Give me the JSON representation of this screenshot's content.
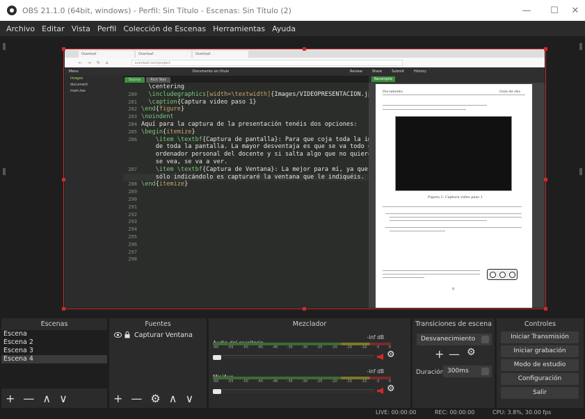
{
  "window": {
    "title": "OBS 21.1.0 (64bit, windows) - Perfil: Sin Título - Escenas: Sin Título (2)",
    "minimize": "—",
    "maximize": "☐",
    "close": "✕"
  },
  "menu": [
    "Archivo",
    "Editar",
    "Vista",
    "Perfil",
    "Colección de Escenas",
    "Herramientas",
    "Ayuda"
  ],
  "capture": {
    "browser_tabs": [
      "Overleaf",
      "Overleaf",
      "Overleaf"
    ],
    "url": "overleaf.com/project",
    "overleaf_toolbar": [
      "Menu",
      "Documento sin título",
      "Review",
      "Share",
      "Submit",
      "History"
    ],
    "editor_tabs": [
      "Source",
      "Rich Text"
    ],
    "left_rows": [
      "Images",
      "document",
      "main.tex"
    ],
    "recompile": "Recompile",
    "code_lines": [
      {
        "n": "",
        "segs": [
          {
            "t": "  \\centering",
            "c": "plain"
          }
        ]
      },
      {
        "n": "280",
        "segs": [
          {
            "t": "  \\includegraphics",
            "c": "cmd"
          },
          {
            "t": "[width=\\textwidth]",
            "c": "kw"
          },
          {
            "t": "{Images/VIDEOPRESENTACION.jpg}",
            "c": "plain"
          }
        ]
      },
      {
        "n": "281",
        "segs": [
          {
            "t": "  \\caption",
            "c": "cmd"
          },
          {
            "t": "{Captura video paso 1}",
            "c": "plain"
          }
        ]
      },
      {
        "n": "282",
        "segs": [
          {
            "t": "\\end",
            "c": "cmd"
          },
          {
            "t": "{",
            "c": "plain"
          },
          {
            "t": "figure",
            "c": "kw"
          },
          {
            "t": "}",
            "c": "plain"
          }
        ]
      },
      {
        "n": "283",
        "segs": [
          {
            "t": "\\noindent",
            "c": "cmd"
          }
        ]
      },
      {
        "n": "284",
        "segs": [
          {
            "t": "Aquí para la captura de la presentación tenéis dos opciones:",
            "c": "plain"
          }
        ]
      },
      {
        "n": "285",
        "segs": [
          {
            "t": "\\begin",
            "c": "cmd"
          },
          {
            "t": "{",
            "c": "plain"
          },
          {
            "t": "itemize",
            "c": "kw"
          },
          {
            "t": "}",
            "c": "plain"
          }
        ]
      },
      {
        "n": "286",
        "segs": [
          {
            "t": "    \\item \\textbf",
            "c": "cmd"
          },
          {
            "t": "{Captura de pantalla}: Para que coja toda la imagen",
            "c": "plain"
          }
        ]
      },
      {
        "n": "",
        "segs": [
          {
            "t": "    de toda la pantalla. La mayor desventaja es que se va todo el",
            "c": "plain"
          }
        ]
      },
      {
        "n": "",
        "segs": [
          {
            "t": "    ordenador personal del docente y si salta algo que no quiere que",
            "c": "plain"
          }
        ]
      },
      {
        "n": "",
        "segs": [
          {
            "t": "    se vea, se va a ver.",
            "c": "plain"
          }
        ]
      },
      {
        "n": "287",
        "segs": [
          {
            "t": "    \\item \\textbf",
            "c": "cmd"
          },
          {
            "t": "{Captura de Ventana}: La mejor para mí, ya que,",
            "c": "plain"
          }
        ]
      },
      {
        "n": "",
        "segs": [
          {
            "t": "    sólo indicándolo es capturaré la ventana que le indiquéis.",
            "c": "plain"
          }
        ]
      },
      {
        "n": "288",
        "segs": [
          {
            "t": "\\end",
            "c": "cmd"
          },
          {
            "t": "{",
            "c": "plain"
          },
          {
            "t": "itemize",
            "c": "kw"
          },
          {
            "t": "}",
            "c": "plain"
          }
        ]
      },
      {
        "n": "289",
        "segs": []
      },
      {
        "n": "290",
        "segs": []
      },
      {
        "n": "291",
        "segs": []
      },
      {
        "n": "292",
        "segs": []
      },
      {
        "n": "293",
        "segs": []
      },
      {
        "n": "294",
        "segs": []
      },
      {
        "n": "295",
        "segs": []
      },
      {
        "n": "296",
        "segs": []
      },
      {
        "n": "297",
        "segs": []
      },
      {
        "n": "298",
        "segs": []
      }
    ],
    "pdf": {
      "header_left": "Documento",
      "header_right": "Guía de obs",
      "caption": "Figura 1: Captura video paso 1",
      "page_number": "8"
    }
  },
  "docks": {
    "scenes": {
      "title": "Escenas",
      "items": [
        "Escena",
        "Escena 2",
        "Escena 3",
        "Escena 4"
      ],
      "selected": 3,
      "footer": [
        "+",
        "—",
        "∧",
        "∨"
      ]
    },
    "sources": {
      "title": "Fuentes",
      "items": [
        {
          "label": "Capturar Ventana"
        }
      ],
      "footer": [
        "+",
        "—",
        "⚙",
        "∧",
        "∨"
      ]
    },
    "mixer": {
      "title": "Mezclador",
      "tracks": [
        {
          "name": "Audio del escritorio",
          "db": "-inf dB"
        },
        {
          "name": "Mic/Aux",
          "db": "-inf dB"
        }
      ],
      "ticks": [
        "-60",
        "-55",
        "-50",
        "-45",
        "-40",
        "-35",
        "-30",
        "-25",
        "-20",
        "-15",
        "-10",
        "-5",
        "0"
      ]
    },
    "transitions": {
      "title": "Transiciones de escena",
      "selected": "Desvanecimiento",
      "plus": "+",
      "minus": "—",
      "duration_label": "Duración",
      "duration_value": "300ms"
    },
    "controls": {
      "title": "Controles",
      "buttons": [
        "Iniciar Transmisión",
        "Iniciar grabación",
        "Modo de estudio",
        "Configuración",
        "Salir"
      ]
    }
  },
  "status": {
    "live": "LIVE: 00:00:00",
    "rec": "REC: 00:00:00",
    "cpu": "CPU: 3.8%, 30.00 fps"
  },
  "colors": {
    "accent_red": "#cc2b2b",
    "panel": "#2b2b2b",
    "background": "#1e1e1e"
  }
}
